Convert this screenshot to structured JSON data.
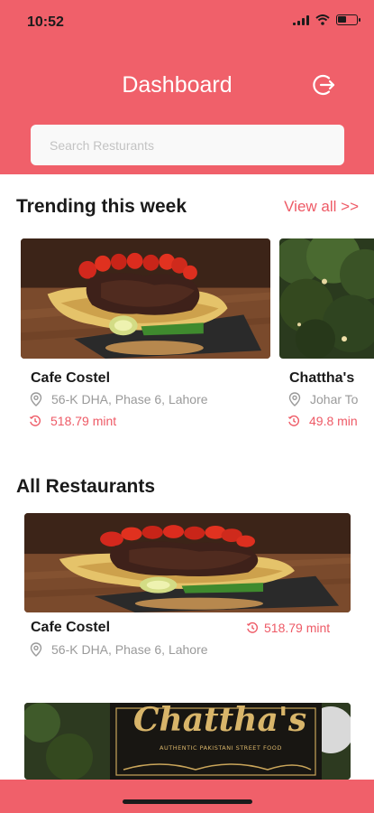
{
  "status": {
    "time": "10:52"
  },
  "header": {
    "title": "Dashboard",
    "logout_icon": "logout-icon"
  },
  "search": {
    "placeholder": "Search Resturants"
  },
  "trending": {
    "title": "Trending this week",
    "view_all": "View all >>",
    "items": [
      {
        "name": "Cafe Costel",
        "address": "56-K DHA, Phase 6, Lahore",
        "time": "518.79 mint"
      },
      {
        "name": "Chattha's",
        "address": "Johar To",
        "time": "49.8 min"
      }
    ]
  },
  "all_restaurants": {
    "title": "All Restaurants",
    "items": [
      {
        "name": "Cafe Costel",
        "address": "56-K DHA, Phase 6, Lahore",
        "time": "518.79 mint"
      },
      {
        "sign_text": "Chattha's",
        "sign_subtext": "AUTHENTIC PAKISTANI STREET FOOD"
      }
    ]
  },
  "colors": {
    "brand": "#f0606a",
    "accent_text": "#ee5a66",
    "muted_text": "#9a9a9a"
  }
}
